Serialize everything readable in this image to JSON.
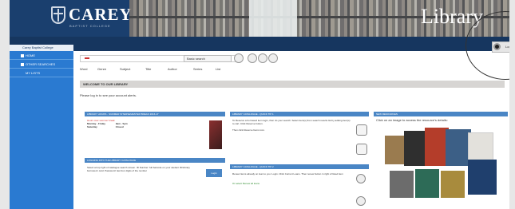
{
  "header": {
    "brand": "CAREY",
    "brand_sub": "BAPTIST COLLEGE",
    "title": "Library"
  },
  "top": {
    "login_label": "Login"
  },
  "sidebar": {
    "title": "Carey Baptist College",
    "items": [
      {
        "label": "HOME"
      },
      {
        "label": "OTHER SEARCHES"
      },
      {
        "label": "MY LISTS"
      }
    ]
  },
  "search": {
    "select_value": "Basic search"
  },
  "tabs": [
    "Word",
    "Genre",
    "Subject",
    "Title",
    "Author",
    "Series",
    "List"
  ],
  "welcome": {
    "title": "WELCOME TO OUR LIBRARY",
    "text": "Please log in to see your account alerts."
  },
  "hours": {
    "title": "LIBRARY HOURS - SUMMER INTERSEMESTER BREAK 2016-17",
    "note": "Hours over summer break",
    "rows": [
      {
        "days": "Monday - Friday",
        "time": "9am - 5pm"
      },
      {
        "days": "Saturday",
        "time": "Closed"
      }
    ]
  },
  "logging": {
    "title": "LOGGING INTO THE LIBRARY CATALOGUE",
    "text": "Select at top right of catalogue search screen. ID Number: full barcode on your student ID/Library borrowers' card. Password: last four digits of the number",
    "button": "Login"
  },
  "tip1": {
    "title": "LIBRARY CATALOGUE - QUICK TIP 1",
    "text": "To Reserve a borrowed item login, then do your search. Select item(s) from search results list by adding item(s) to cart. Click Reserve button.",
    "text2": "Then click Reserve Items icon."
  },
  "tip2": {
    "title": "LIBRARY CATALOGUE - QUICK TIP 2",
    "text": "Renew items already on loan to you: Login. Click Current Loans. Then renew button in right of listed item",
    "text2": "Or select Renew all loans"
  },
  "resources": {
    "title": "NEW RESOURCES",
    "text": "Click on an image to access the resource's details:"
  }
}
